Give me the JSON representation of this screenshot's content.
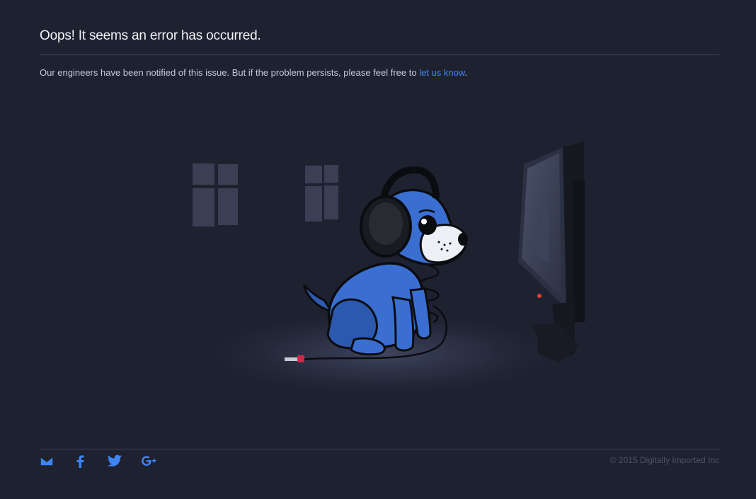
{
  "error": {
    "headline": "Oops! It seems an error has occurred.",
    "message_before": "Our engineers have been notified of this issue. But if the problem persists, please feel free to ",
    "link_text": "let us know",
    "message_after": "."
  },
  "colors": {
    "background": "#1e2230",
    "link": "#3e84f5",
    "dog_blue": "#3a6fd1"
  },
  "footer": {
    "social": [
      {
        "name": "email",
        "icon": "mail-icon"
      },
      {
        "name": "facebook",
        "icon": "facebook-icon"
      },
      {
        "name": "twitter",
        "icon": "twitter-icon"
      },
      {
        "name": "google-plus",
        "icon": "google-plus-icon"
      }
    ],
    "copyright": "© 2015 Digitally Imported Inc"
  }
}
